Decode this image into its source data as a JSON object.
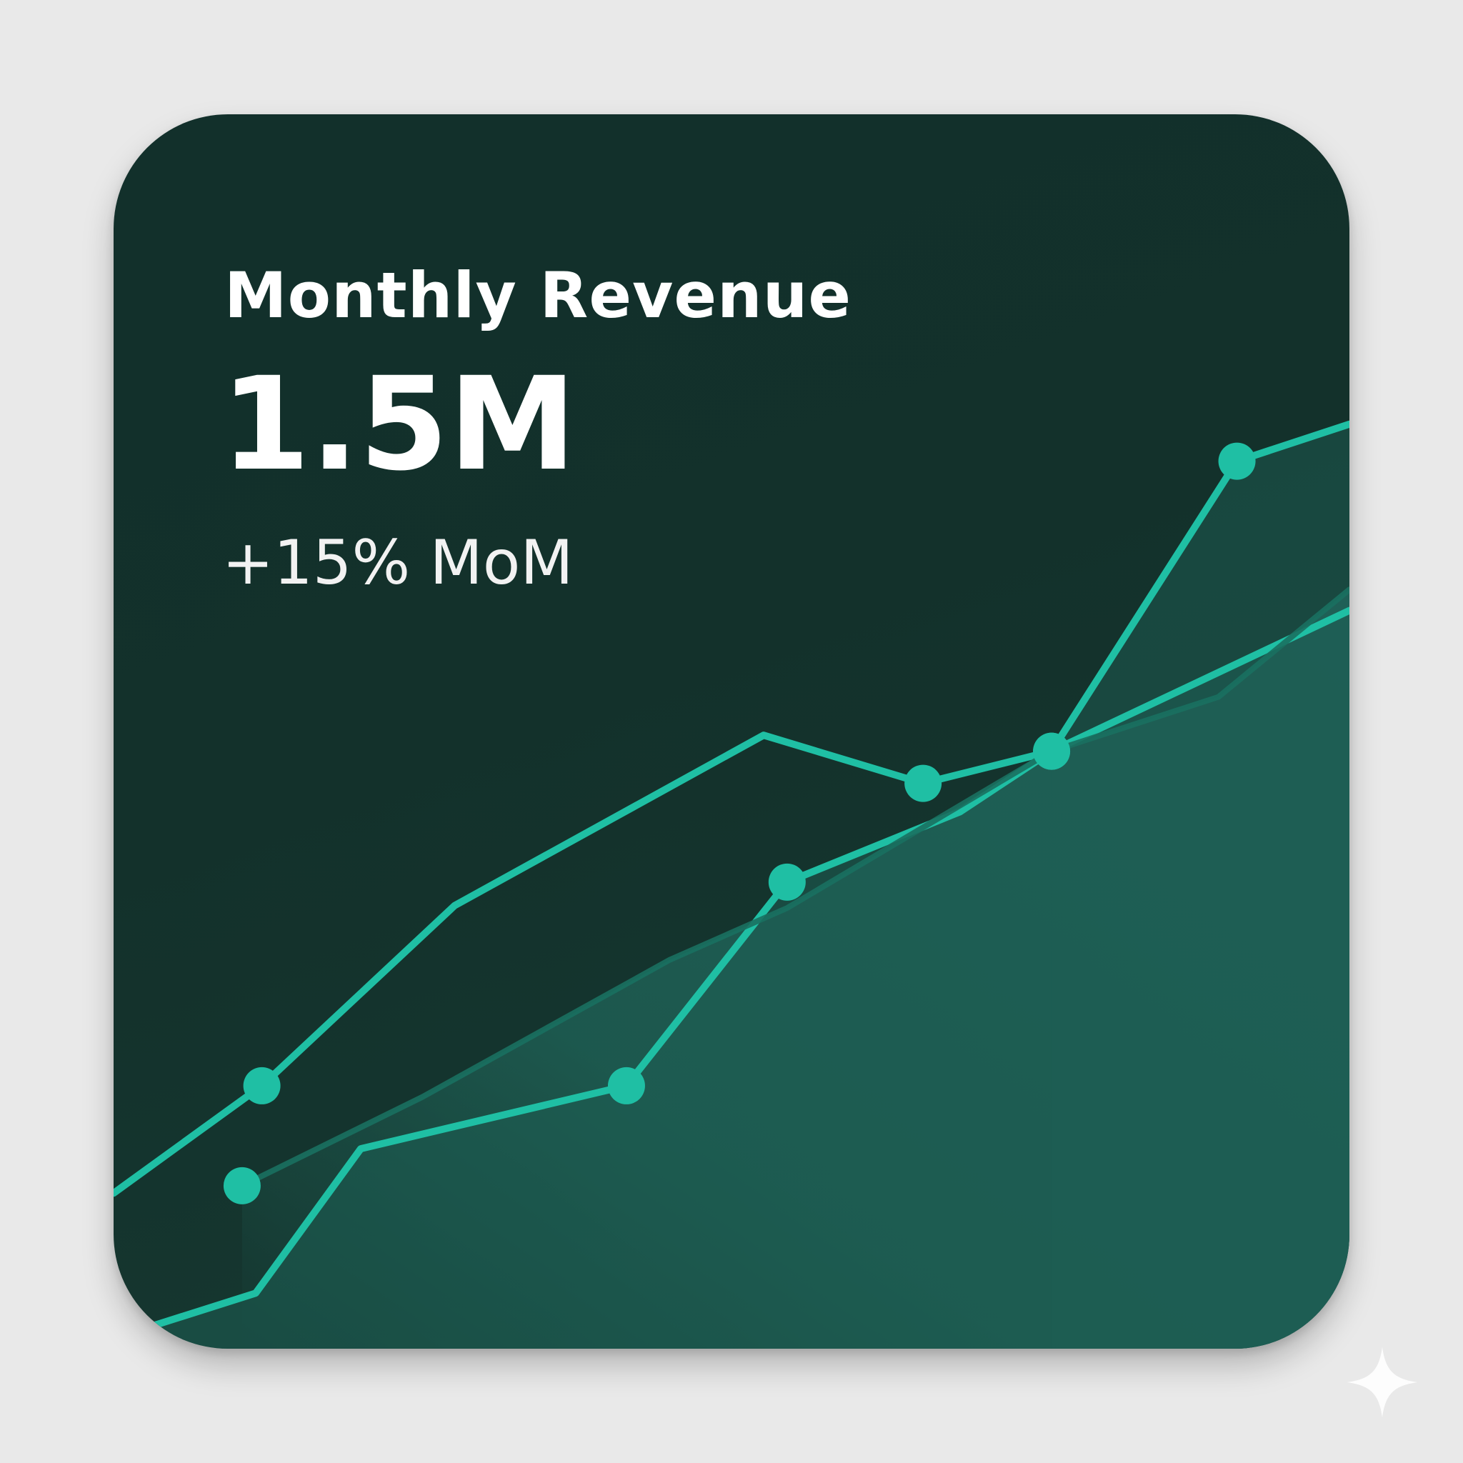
{
  "card": {
    "title": "Monthly Revenue",
    "value": "1.5M",
    "change": "+15% MoM"
  },
  "colors": {
    "page_background": "#e9e9e9",
    "card_background": "#13312b",
    "accent_line": "#1fbfa4",
    "secondary_line": "#1a7060",
    "area_fill": "#1e5e53",
    "title_text": "#ffffff"
  },
  "chart_data": {
    "type": "line",
    "title": "",
    "xlabel": "",
    "ylabel": "",
    "grid": false,
    "legend": "none",
    "xlim": [
      0,
      100
    ],
    "ylim": [
      0,
      100
    ],
    "series": [
      {
        "x": [
          0,
          12,
          27.6,
          52.6,
          65.5,
          75.9,
          90.9,
          100
        ],
        "y": [
          12.6,
          21.3,
          35.9,
          49.7,
          45.8,
          48.4,
          71.9,
          74.9
        ],
        "markers": [
          12,
          65.5,
          75.9,
          90.9
        ]
      },
      {
        "x": [
          3,
          11.5,
          20,
          41.5,
          54.5,
          68.5,
          75.9,
          100
        ],
        "y": [
          1.8,
          4.5,
          16.2,
          21.3,
          37.8,
          43.5,
          48.4,
          59.8
        ],
        "markers": [
          41.5,
          54.5,
          75.9
        ]
      },
      {
        "x": [
          10.4,
          25,
          45,
          54.5,
          75.9,
          89.4,
          100
        ],
        "y": [
          13.2,
          20.4,
          31.5,
          35.7,
          48.4,
          52.8,
          61.5
        ],
        "markers": [
          10.4
        ]
      }
    ]
  }
}
